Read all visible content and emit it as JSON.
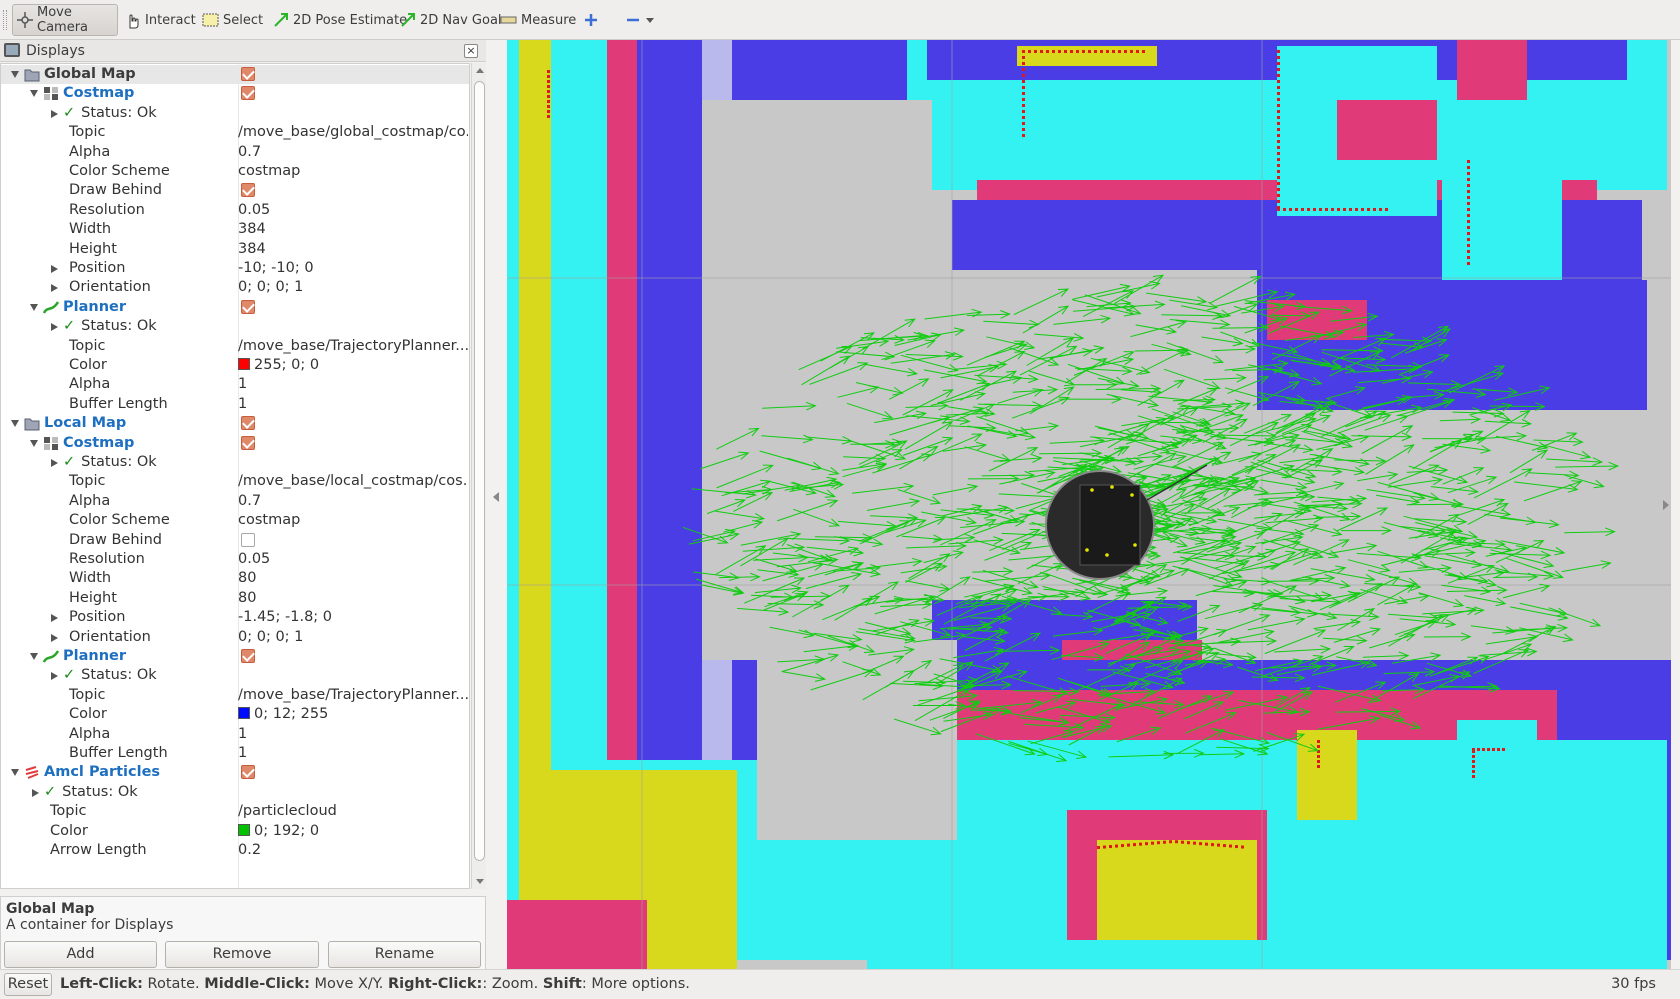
{
  "toolbar": {
    "tools": [
      {
        "id": "move-camera",
        "label": "Move Camera",
        "active": true
      },
      {
        "id": "interact",
        "label": "Interact"
      },
      {
        "id": "select",
        "label": "Select"
      },
      {
        "id": "pose-estimate",
        "label": "2D Pose Estimate"
      },
      {
        "id": "nav-goal",
        "label": "2D Nav Goal"
      },
      {
        "id": "measure",
        "label": "Measure"
      }
    ]
  },
  "displays": {
    "title": "Displays",
    "rows": [
      {
        "label": "Global Map",
        "kind": "top-group",
        "check": true,
        "expanded": true
      },
      {
        "label": "Costmap",
        "kind": "group",
        "check": true
      },
      {
        "label": "Status: Ok",
        "kind": "status"
      },
      {
        "label": "Topic",
        "value": "/move_base/global_costmap/co..."
      },
      {
        "label": "Alpha",
        "value": "0.7"
      },
      {
        "label": "Color Scheme",
        "value": "costmap"
      },
      {
        "label": "Draw Behind",
        "check": true
      },
      {
        "label": "Resolution",
        "value": "0.05"
      },
      {
        "label": "Width",
        "value": "384"
      },
      {
        "label": "Height",
        "value": "384"
      },
      {
        "label": "Position",
        "value": "-10; -10; 0"
      },
      {
        "label": "Orientation",
        "value": "0; 0; 0; 1"
      },
      {
        "label": "Planner",
        "kind": "group",
        "check": true
      },
      {
        "label": "Status: Ok",
        "kind": "status"
      },
      {
        "label": "Topic",
        "value": "/move_base/TrajectoryPlanner..."
      },
      {
        "label": "Color",
        "value": "255; 0; 0",
        "swatch": "#ff0000"
      },
      {
        "label": "Alpha",
        "value": "1"
      },
      {
        "label": "Buffer Length",
        "value": "1"
      },
      {
        "label": "Local Map",
        "kind": "top-group",
        "check": true
      },
      {
        "label": "Costmap",
        "kind": "group",
        "check": true
      },
      {
        "label": "Status: Ok",
        "kind": "status"
      },
      {
        "label": "Topic",
        "value": "/move_base/local_costmap/cos..."
      },
      {
        "label": "Alpha",
        "value": "0.7"
      },
      {
        "label": "Color Scheme",
        "value": "costmap"
      },
      {
        "label": "Draw Behind",
        "check": false
      },
      {
        "label": "Resolution",
        "value": "0.05"
      },
      {
        "label": "Width",
        "value": "80"
      },
      {
        "label": "Height",
        "value": "80"
      },
      {
        "label": "Position",
        "value": "-1.45; -1.8; 0"
      },
      {
        "label": "Orientation",
        "value": "0; 0; 0; 1"
      },
      {
        "label": "Planner",
        "kind": "group",
        "check": true
      },
      {
        "label": "Status: Ok",
        "kind": "status"
      },
      {
        "label": "Topic",
        "value": "/move_base/TrajectoryPlanner..."
      },
      {
        "label": "Color",
        "value": "0; 12; 255",
        "swatch": "#000cff"
      },
      {
        "label": "Alpha",
        "value": "1"
      },
      {
        "label": "Buffer Length",
        "value": "1"
      },
      {
        "label": "Amcl Particles",
        "kind": "top-group",
        "check": true
      },
      {
        "label": "Status: Ok",
        "kind": "status"
      },
      {
        "label": "Topic",
        "value": "/particlecloud"
      },
      {
        "label": "Color",
        "value": "0; 192; 0",
        "swatch": "#00c000"
      },
      {
        "label": "Arrow Length",
        "value": "0.2"
      }
    ]
  },
  "description": {
    "title": "Global Map",
    "text": "A container for Displays"
  },
  "buttons": {
    "add": "Add",
    "remove": "Remove",
    "rename": "Rename"
  },
  "status": {
    "reset": "Reset",
    "hint_parts": [
      {
        "b": "Left-Click:",
        "t": " Rotate. "
      },
      {
        "b": "Middle-Click:",
        "t": " Move X/Y. "
      },
      {
        "b": "Right-Click:",
        "t": ": Zoom. "
      },
      {
        "b": "Shift",
        "t": ": More options."
      }
    ],
    "fps": "30 fps"
  },
  "colors": {
    "particles": "#11cc11",
    "cyan": "#35f2f2",
    "blue": "#4b3de6",
    "magenta": "#e03a78",
    "yellow": "#d8d81c",
    "gray": "#c8c8c8"
  }
}
